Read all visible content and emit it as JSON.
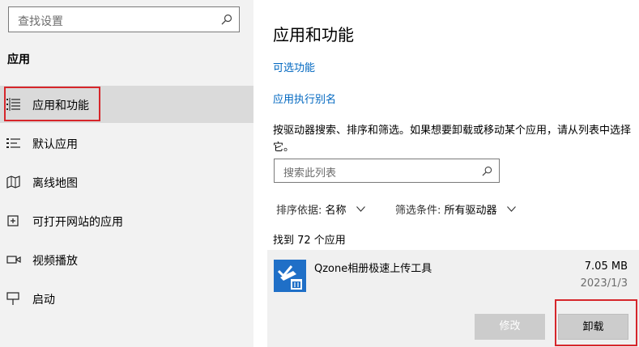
{
  "sidebar": {
    "search_placeholder": "查找设置",
    "section_title": "应用",
    "items": [
      {
        "label": "应用和功能",
        "icon": "apps-features-icon",
        "selected": true
      },
      {
        "label": "默认应用",
        "icon": "default-apps-icon",
        "selected": false
      },
      {
        "label": "离线地图",
        "icon": "offline-maps-icon",
        "selected": false
      },
      {
        "label": "可打开网站的应用",
        "icon": "apps-for-websites-icon",
        "selected": false
      },
      {
        "label": "视频播放",
        "icon": "video-playback-icon",
        "selected": false
      },
      {
        "label": "启动",
        "icon": "startup-icon",
        "selected": false
      }
    ]
  },
  "main": {
    "title": "应用和功能",
    "links": {
      "optional_features": "可选功能",
      "app_execution_aliases": "应用执行别名"
    },
    "description": "按驱动器搜索、排序和筛选。如果想要卸载或移动某个应用，请从列表中选择它。",
    "search_placeholder": "搜索此列表",
    "sort": {
      "label": "排序依据:",
      "value": "名称"
    },
    "filter": {
      "label": "筛选条件:",
      "value": "所有驱动器"
    },
    "found_text": "找到 72 个应用",
    "app": {
      "name": "Qzone相册极速上传工具",
      "size": "7.05 MB",
      "date": "2023/1/3",
      "icon": "qzone-uploader-icon"
    },
    "buttons": {
      "modify": "修改",
      "uninstall": "卸载"
    }
  },
  "colors": {
    "link": "#0067c0",
    "highlight_outline": "#d6262b",
    "sidebar_bg": "#f2f2f2",
    "selected_bg": "#dadada"
  }
}
